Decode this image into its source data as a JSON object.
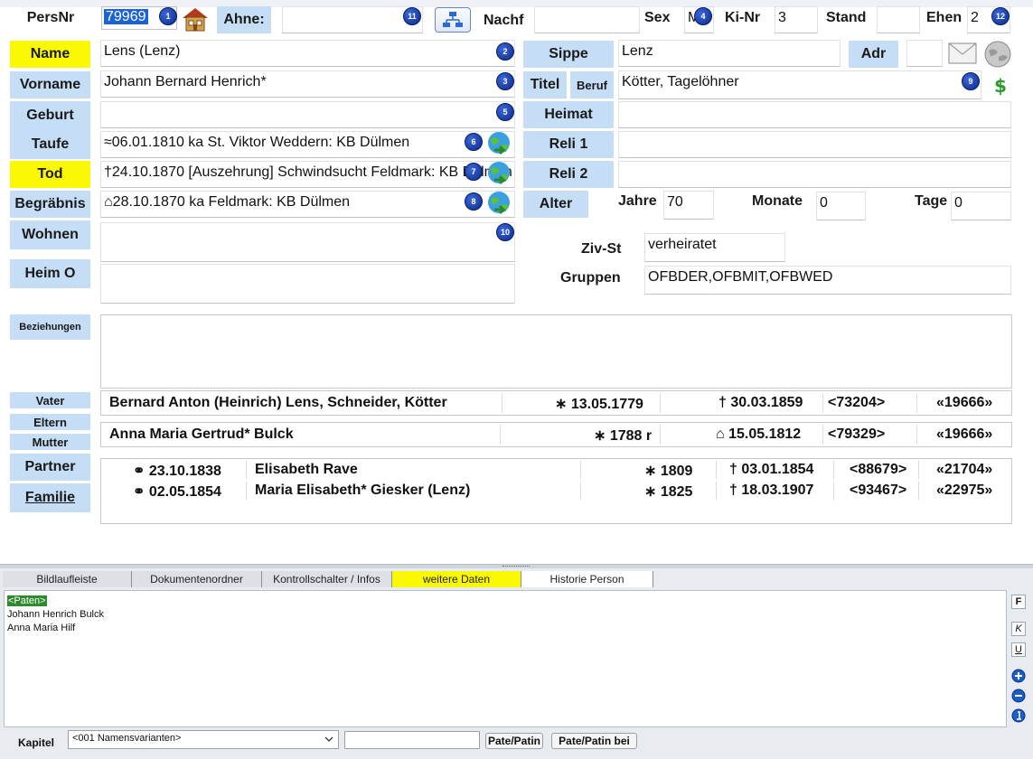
{
  "header": {
    "persnr_label": "PersNr",
    "persnr_value": "79969",
    "ahne_label": "Ahne:",
    "ahne_value": "",
    "nachf_label": "Nachf",
    "nachf_value": "",
    "sex_label": "Sex",
    "sex_value": "M",
    "kinr_label": "Ki-Nr",
    "kinr_value": "3",
    "stand_label": "Stand",
    "stand_value": "",
    "ehen_label": "Ehen",
    "ehen_value": "2"
  },
  "badges": [
    "1",
    "2",
    "3",
    "4",
    "5",
    "6",
    "7",
    "8",
    "9",
    "10",
    "11",
    "12"
  ],
  "left_labels": {
    "name": "Name",
    "vorname": "Vorname",
    "geburt": "Geburt",
    "taufe": "Taufe",
    "tod": "Tod",
    "begraebnis": "Begräbnis",
    "wohnen": "Wohnen",
    "heim_o": "Heim O",
    "beziehungen": "Beziehungen",
    "vater": "Vater",
    "eltern": "Eltern",
    "mutter": "Mutter",
    "partner": "Partner",
    "familie": "Familie"
  },
  "left_values": {
    "name": "Lens (Lenz)",
    "vorname": "Johann Bernard Henrich*",
    "geburt": "",
    "taufe": "≈06.01.1810 ka St. Viktor Weddern: KB Dülmen",
    "tod": "†24.10.1870 [Auszehrung] Schwindsucht Feldmark: KB Dülmen",
    "begraebnis": "⌂28.10.1870 ka Feldmark: KB Dülmen",
    "wohnen": "",
    "heim_o": "",
    "beziehungen": ""
  },
  "right_labels": {
    "sippe": "Sippe",
    "adr": "Adr",
    "titel": "Titel",
    "beruf": "Beruf",
    "heimat": "Heimat",
    "reli1": "Reli 1",
    "reli2": "Reli 2",
    "alter": "Alter",
    "jahre": "Jahre",
    "monate": "Monate",
    "tage": "Tage",
    "zivst": "Ziv-St",
    "gruppen": "Gruppen"
  },
  "right_values": {
    "sippe": "Lenz",
    "adr": "",
    "beruf": "Kötter, Tagelöhner",
    "heimat": "",
    "reli1": "",
    "reli2": "",
    "jahre": "70",
    "monate": "0",
    "tage": "0",
    "zivst": "verheiratet",
    "gruppen": "OFBDER,OFBMIT,OFBWED"
  },
  "vater": {
    "name": "Bernard Anton (Heinrich) Lens, Schneider, Kötter",
    "birth": "∗ 13.05.1779",
    "death": "† 30.03.1859",
    "persnr": "<73204>",
    "family": "«19666»"
  },
  "mutter": {
    "name": "Anna Maria Gertrud* Bulck",
    "birth": "∗ 1788 r",
    "death": "⌂ 15.05.1812",
    "persnr": "<79329>",
    "family": "«19666»"
  },
  "partners": [
    {
      "marriage": "⚭ 23.10.1838",
      "name": "Elisabeth Rave",
      "birth": "∗ 1809",
      "death": "† 03.01.1854",
      "persnr": "<88679>",
      "family": "«21704»"
    },
    {
      "marriage": "⚭ 02.05.1854",
      "name": "Maria Elisabeth* Giesker (Lenz)",
      "birth": "∗ 1825",
      "death": "† 18.03.1907",
      "persnr": "<93467>",
      "family": "«22975»"
    }
  ],
  "tabs": [
    "Bildlaufleiste",
    "Dokumentenordner",
    "Kontrollschalter / Infos",
    "weitere Daten",
    "Historie Person"
  ],
  "notes": {
    "tag": "<Paten>",
    "line1": "Johann Henrich Bulck",
    "line2": "Anna Maria Hilf"
  },
  "side_buttons": {
    "bold": "F",
    "italic": "K",
    "underline": "U"
  },
  "bottom": {
    "kapitel_label": "Kapitel",
    "kapitel_value": "<001 Namensvarianten>",
    "input_value": "",
    "btn_pate": "Pate/Patin",
    "btn_pate_bei": "Pate/Patin bei"
  },
  "colors": {
    "label_bg": "#c5ddf5",
    "highlight": "#fbf806",
    "badge": "#0b2a8a",
    "tag_bg": "#2d8a2d"
  }
}
